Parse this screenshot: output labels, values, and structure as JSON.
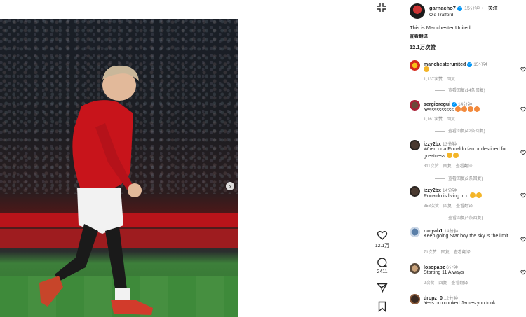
{
  "post": {
    "username": "garnacho7",
    "verified_badge": "✓",
    "time": "15分钟",
    "follow_label": "关注",
    "separator": "•",
    "location": "Old Trafford",
    "caption": "This is Manchester United.",
    "translate_label": "查看翻译",
    "likes": "12.1万次赞"
  },
  "actions": {
    "like_count": "12.1万",
    "comment_count": "2411"
  },
  "comments": [
    {
      "user": "manchesterunited",
      "verified": true,
      "time": "15分钟",
      "text": "",
      "emoji": [
        "🤩"
      ],
      "likes": "1,137次赞",
      "reply": "回复",
      "translate": "",
      "replies": "查看回复(14条回复)"
    },
    {
      "user": "sergioregui",
      "verified": true,
      "time": "14分钟",
      "text": "Yessssssssss",
      "emoji": [
        "😍",
        "😍",
        "😍",
        "😍"
      ],
      "likes": "1,161次赞",
      "reply": "回复",
      "translate": "",
      "replies": "查看回复(42条回复)"
    },
    {
      "user": "izzy2bx",
      "verified": false,
      "time": "13分钟",
      "text": "When ur a Ronaldo fan ur destined for greatness",
      "emoji": [
        "😭",
        "😭"
      ],
      "likes": "311次赞",
      "reply": "回复",
      "translate": "查看翻译",
      "replies": "查看回复(2条回复)"
    },
    {
      "user": "izzy2bx",
      "verified": false,
      "time": "14分钟",
      "text": "Ronaldo is living in u",
      "emoji": [
        "👏",
        "😭"
      ],
      "likes": "358次赞",
      "reply": "回复",
      "translate": "查看翻译",
      "replies": "查看回复(4条回复)"
    },
    {
      "user": "runyab1",
      "verified": false,
      "time": "14分钟",
      "text": "Keep going Star boy the sky is the limit",
      "emoji": [],
      "likes": "71次赞",
      "reply": "回复",
      "translate": "查看翻译",
      "replies": ""
    },
    {
      "user": "losopabz",
      "verified": false,
      "time": "6分钟",
      "text": "Starting 11 Always",
      "emoji": [],
      "likes": "2次赞",
      "reply": "回复",
      "translate": "查看翻译",
      "replies": ""
    },
    {
      "user": "dropz_0",
      "verified": false,
      "time": "12分钟",
      "text": "Yess bro cooked James you took",
      "emoji": [],
      "likes": "",
      "reply": "",
      "translate": "",
      "replies": ""
    }
  ],
  "icons": {
    "expand": "expand-icon",
    "heart": "heart-icon",
    "comment": "comment-icon",
    "share": "share-icon",
    "save": "bookmark-icon",
    "next": "›"
  },
  "colors": {
    "accent": "#0095f6",
    "text": "#262626",
    "muted": "#8e8e8e",
    "jersey": "#c8141b"
  }
}
